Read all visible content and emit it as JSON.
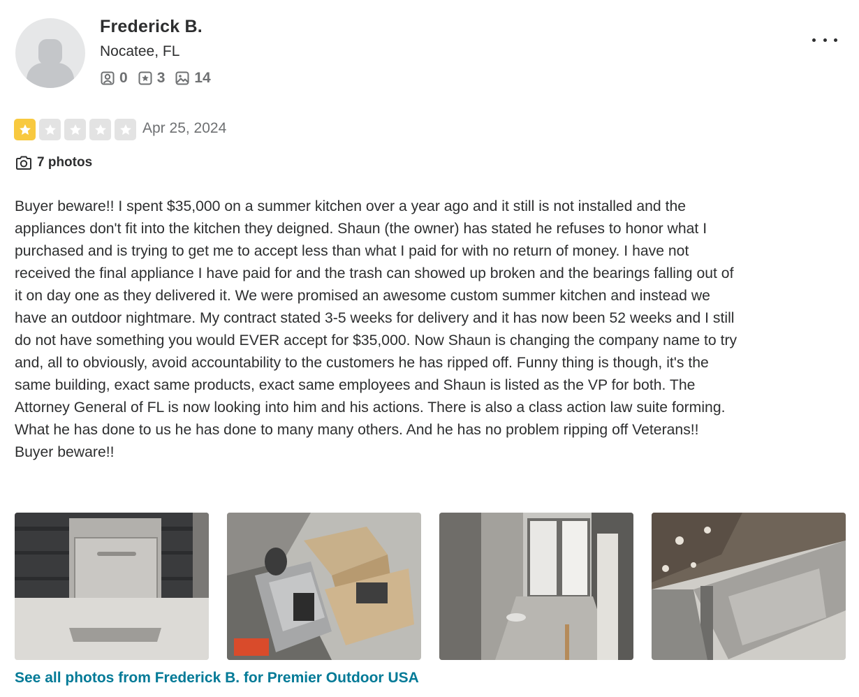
{
  "user": {
    "name": "Frederick B.",
    "location": "Nocatee, FL",
    "stats": {
      "friends": "0",
      "reviews": "3",
      "photos": "14"
    }
  },
  "review": {
    "rating": 1,
    "max_rating": 5,
    "date": "Apr 25, 2024",
    "photo_count_label": "7 photos",
    "text": "Buyer beware!! I spent $35,000 on a summer kitchen over a year ago and it still is not installed and the appliances don't fit into the kitchen they deigned. Shaun (the owner) has stated he refuses to honor what I purchased and is trying to get me to accept less than what I paid for with no return of money. I have not received the final appliance I have paid for and the trash can showed up broken and the bearings falling out of it on day one as they delivered it. We were promised an awesome custom summer kitchen and instead we have an outdoor nightmare. My contract stated 3-5 weeks for delivery and it has now been 52 weeks and I still do not have something you would EVER accept for $35,000. Now Shaun is changing the company name to try and, all to obviously, avoid accountability to the customers he has ripped off. Funny thing is though, it's the same building, exact same products, exact same employees and Shaun is listed as the VP for both. The Attorney General of FL is now looking into him and his actions. There is also a class action law suite forming. What he has done to us he has done to many many others. And he has no problem ripping off Veterans!! Buyer beware!!",
    "see_all_link": "See all photos from Frederick B. for Premier Outdoor USA"
  },
  "colors": {
    "star_filled": "#f8c93f",
    "star_empty": "#e3e3e3",
    "link": "#027a97",
    "text": "#2d2e2f",
    "muted": "#6e7072"
  },
  "icons": {
    "friends": "friends-icon",
    "reviews": "review-star-icon",
    "photos": "photo-icon",
    "camera": "camera-icon",
    "more": "more-options-icon"
  }
}
